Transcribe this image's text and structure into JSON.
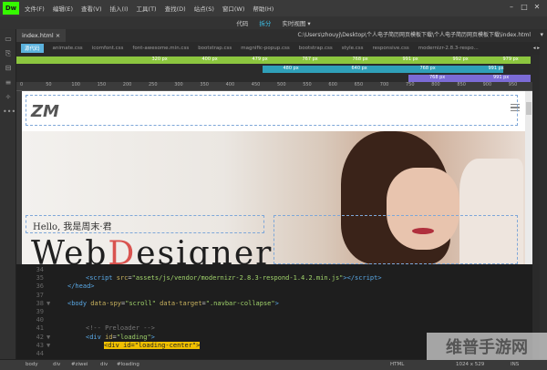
{
  "app": {
    "logo": "Dw"
  },
  "menu": [
    "文件(F)",
    "编辑(E)",
    "查看(V)",
    "插入(I)",
    "工具(T)",
    "查找(D)",
    "站点(S)",
    "窗口(W)",
    "帮助(H)"
  ],
  "views": {
    "code": "代码",
    "split": "拆分",
    "live": "实时视图 ▾"
  },
  "doc": {
    "tab": "index.html",
    "path": "C:\\Users\\zhouyj\\Desktop\\个人电子简历网页模板下载\\个人电子简历网页模板下载\\index.html"
  },
  "files": [
    "源代码",
    "animate.css",
    "icomfont.css",
    "font-awesome.min.css",
    "bootstrap.css",
    "magnific-popup.css",
    "bootstrap.css",
    "style.css",
    "responsive.css",
    "modernizr-2.8.3-respo..."
  ],
  "media_queries": {
    "green": [
      "320 px",
      "400 px",
      "479 px",
      "767 px",
      "768 px",
      "991 px",
      "992 px",
      "979 px"
    ],
    "teal": [
      "480 px",
      "640 px",
      "768 px",
      "991 px"
    ],
    "purple": [
      "768 px",
      "991 px"
    ]
  },
  "ruler": [
    "0",
    "50",
    "100",
    "150",
    "200",
    "250",
    "300",
    "350",
    "400",
    "450",
    "500",
    "550",
    "600",
    "650",
    "700",
    "750",
    "800",
    "850",
    "900",
    "950"
  ],
  "page": {
    "site_logo": "ZM",
    "hello": "Hello, 我是周末·君",
    "title_a": "Web",
    "title_red": "D",
    "title_b": "esigner"
  },
  "code": [
    {
      "n": "34",
      "html": ""
    },
    {
      "n": "35",
      "html": "<span class=\"tag\">&lt;script</span> <span class=\"attr\">src</span>=<span class=\"str\">\"assets/js/vendor/modernizr-2.8.3-respond-1.4.2.min.js\"</span><span class=\"tag\">&gt;&lt;/script&gt;</span>",
      "indent": 1
    },
    {
      "n": "36",
      "html": "<span class=\"tag\">&lt;/head&gt;</span>"
    },
    {
      "n": "37",
      "html": ""
    },
    {
      "n": "38",
      "html": "<span class=\"tag\">&lt;body</span> <span class=\"attr\">data-spy</span>=<span class=\"str\">\"scroll\"</span> <span class=\"attr\">data-target</span>=<span class=\"str\">\".navbar-collapse\"</span><span class=\"tag\">&gt;</span>",
      "fold": true
    },
    {
      "n": "39",
      "html": ""
    },
    {
      "n": "40",
      "html": ""
    },
    {
      "n": "41",
      "html": "<span class=\"cmt\">&lt;!-- Preloader --&gt;</span>",
      "indent": 1
    },
    {
      "n": "42",
      "html": "<span class=\"tag\">&lt;div</span> <span class=\"attr\">id</span>=<span class=\"str\">\"loading\"</span><span class=\"tag\">&gt;</span>",
      "indent": 1,
      "fold": true
    },
    {
      "n": "43",
      "html": "&lt;div id=\"loading-center\"&gt;",
      "indent": 2,
      "fold": true,
      "sel": true
    },
    {
      "n": "44",
      "html": ""
    }
  ],
  "status": [
    "body",
    "div",
    "#ziwei",
    "div",
    "#loading",
    "HTML",
    "1024 x 529",
    "INS"
  ],
  "watermark": "维普手游网"
}
